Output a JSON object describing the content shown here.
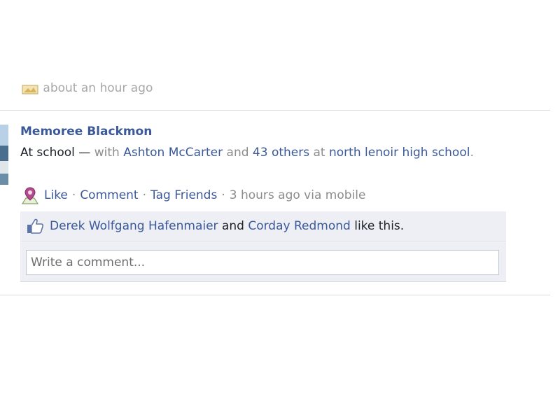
{
  "previous_story": {
    "meta_text": "about an hour ago"
  },
  "story": {
    "author": "Memoree Blackmon",
    "message": {
      "text": "At school",
      "dash": " — ",
      "with_word": "with ",
      "tagged_friend": "Ashton McCarter",
      "and_word": " and ",
      "others_link": "43 others",
      "at_word": " at ",
      "place": "north lenoir high school",
      "period": "."
    },
    "actions": {
      "like": "Like",
      "comment": "Comment",
      "tag_friends": "Tag Friends",
      "timestamp": "3 hours ago via mobile",
      "separator": "·"
    },
    "likes": {
      "liker1": "Derek Wolfgang Hafenmaier",
      "and_word": " and ",
      "liker2": "Corday Redmond",
      "suffix": " like this."
    },
    "comment_input": {
      "placeholder": "Write a comment...",
      "value": ""
    }
  },
  "icons": {
    "prev_story_icon": "photo-icon",
    "location_icon": "location-pin-icon",
    "like_icon": "thumbs-up-icon"
  },
  "colors": {
    "link": "#3b5998",
    "muted": "#8c8c8c",
    "ufi_background": "#edeff4",
    "divider": "#d9dce3"
  }
}
